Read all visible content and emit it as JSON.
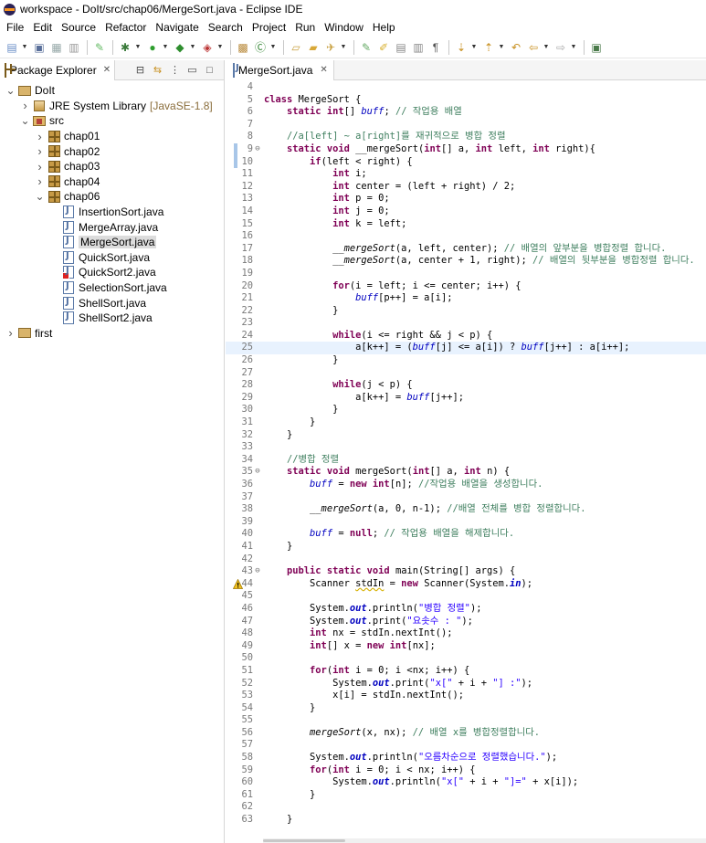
{
  "window": {
    "title": "workspace - DoIt/src/chap06/MergeSort.java - Eclipse IDE"
  },
  "menu": [
    "File",
    "Edit",
    "Source",
    "Refactor",
    "Navigate",
    "Search",
    "Project",
    "Run",
    "Window",
    "Help"
  ],
  "explorer": {
    "tab_label": "Package Explorer",
    "tree": [
      {
        "label": "DoIt",
        "icon": "project-icon",
        "expanded": true,
        "depth": 0
      },
      {
        "label": "JRE System Library",
        "suffix": "[JavaSE-1.8]",
        "icon": "library-icon",
        "expanded": false,
        "depth": 1
      },
      {
        "label": "src",
        "icon": "source-folder-icon",
        "expanded": true,
        "depth": 1
      },
      {
        "label": "chap01",
        "icon": "package-icon",
        "expanded": false,
        "depth": 2
      },
      {
        "label": "chap02",
        "icon": "package-icon",
        "expanded": false,
        "depth": 2
      },
      {
        "label": "chap03",
        "icon": "package-icon",
        "expanded": false,
        "depth": 2
      },
      {
        "label": "chap04",
        "icon": "package-icon",
        "expanded": false,
        "depth": 2
      },
      {
        "label": "chap06",
        "icon": "package-icon",
        "expanded": true,
        "depth": 2
      },
      {
        "label": "InsertionSort.java",
        "icon": "java-file-icon",
        "expanded": false,
        "depth": 3
      },
      {
        "label": "MergeArray.java",
        "icon": "java-file-icon",
        "expanded": false,
        "depth": 3
      },
      {
        "label": "MergeSort.java",
        "icon": "java-file-icon",
        "expanded": false,
        "depth": 3,
        "selected": true
      },
      {
        "label": "QuickSort.java",
        "icon": "java-file-icon",
        "expanded": false,
        "depth": 3
      },
      {
        "label": "QuickSort2.java",
        "icon": "java-file-error-icon",
        "expanded": false,
        "depth": 3
      },
      {
        "label": "SelectionSort.java",
        "icon": "java-file-icon",
        "expanded": false,
        "depth": 3
      },
      {
        "label": "ShellSort.java",
        "icon": "java-file-icon",
        "expanded": false,
        "depth": 3
      },
      {
        "label": "ShellSort2.java",
        "icon": "java-file-icon",
        "expanded": false,
        "depth": 3
      },
      {
        "label": "first",
        "icon": "project-icon",
        "expanded": false,
        "depth": 0
      }
    ]
  },
  "editor": {
    "tab_label": "MergeSort.java",
    "current_line": 25,
    "lines": [
      {
        "n": 4,
        "code": ""
      },
      {
        "n": 5,
        "code": "<span class=\"kw\">class</span> MergeSort {"
      },
      {
        "n": 6,
        "code": "    <span class=\"kw\">static</span> <span class=\"kw\">int</span>[] <span class=\"fi\">buff</span>; <span class=\"cm\">// 작업용 배열</span>"
      },
      {
        "n": 7,
        "code": ""
      },
      {
        "n": 8,
        "code": "    <span class=\"cm\">//a[left] ~ a[right]를 재귀적으로 병합 정렬</span>"
      },
      {
        "n": 9,
        "fold": true,
        "code": "    <span class=\"kw\">static</span> <span class=\"kw\">void</span> __mergeSort(<span class=\"kw\">int</span>[] a, <span class=\"kw\">int</span> left, <span class=\"kw\">int</span> right){"
      },
      {
        "n": 10,
        "code": "        <span class=\"kw\">if</span>(left &lt; right) {"
      },
      {
        "n": 11,
        "code": "            <span class=\"kw\">int</span> i;"
      },
      {
        "n": 12,
        "code": "            <span class=\"kw\">int</span> center = (left + right) / 2;"
      },
      {
        "n": 13,
        "code": "            <span class=\"kw\">int</span> p = 0;"
      },
      {
        "n": 14,
        "code": "            <span class=\"kw\">int</span> j = 0;"
      },
      {
        "n": 15,
        "code": "            <span class=\"kw\">int</span> k = left;"
      },
      {
        "n": 16,
        "code": ""
      },
      {
        "n": 17,
        "code": "            <span class=\"mi\">__mergeSort</span>(a, left, center); <span class=\"cm\">// 배열의 앞부분을 병합정렬 합니다.</span>"
      },
      {
        "n": 18,
        "code": "            <span class=\"mi\">__mergeSort</span>(a, center + 1, right); <span class=\"cm\">// 배열의 뒷부분을 병합정렬 합니다.</span>"
      },
      {
        "n": 19,
        "code": ""
      },
      {
        "n": 20,
        "code": "            <span class=\"kw\">for</span>(i = left; i &lt;= center; i++) {"
      },
      {
        "n": 21,
        "code": "                <span class=\"fi\">buff</span>[p++] = a[i];"
      },
      {
        "n": 22,
        "code": "            }"
      },
      {
        "n": 23,
        "code": ""
      },
      {
        "n": 24,
        "code": "            <span class=\"kw\">while</span>(i &lt;= right &amp;&amp; j &lt; p) {"
      },
      {
        "n": 25,
        "code": "                a[k++] = (<span class=\"fi\">buff</span>[j] &lt;= a[i]) ? <span class=\"fi\">buff</span>[j++] : a[i++];"
      },
      {
        "n": 26,
        "code": "            }"
      },
      {
        "n": 27,
        "code": ""
      },
      {
        "n": 28,
        "code": "            <span class=\"kw\">while</span>(j &lt; p) {"
      },
      {
        "n": 29,
        "code": "                a[k++] = <span class=\"fi\">buff</span>[j++];"
      },
      {
        "n": 30,
        "code": "            }"
      },
      {
        "n": 31,
        "code": "        }"
      },
      {
        "n": 32,
        "code": "    }"
      },
      {
        "n": 33,
        "code": ""
      },
      {
        "n": 34,
        "code": "    <span class=\"cm\">//병합 정렬</span>"
      },
      {
        "n": 35,
        "fold": true,
        "code": "    <span class=\"kw\">static</span> <span class=\"kw\">void</span> mergeSort(<span class=\"kw\">int</span>[] a, <span class=\"kw\">int</span> n) {"
      },
      {
        "n": 36,
        "code": "        <span class=\"fi\">buff</span> = <span class=\"kw\">new</span> <span class=\"kw\">int</span>[n]; <span class=\"cm\">//작업용 배열을 생성합니다.</span>"
      },
      {
        "n": 37,
        "code": ""
      },
      {
        "n": 38,
        "code": "        <span class=\"mi\">__mergeSort</span>(a, 0, n-1); <span class=\"cm\">//배열 전체를 병합 정렬합니다.</span>"
      },
      {
        "n": 39,
        "code": ""
      },
      {
        "n": 40,
        "code": "        <span class=\"fi\">buff</span> = <span class=\"kw\">null</span>; <span class=\"cm\">// 작업용 배열을 해제합니다.</span>"
      },
      {
        "n": 41,
        "code": "    }"
      },
      {
        "n": 42,
        "code": ""
      },
      {
        "n": 43,
        "fold": true,
        "code": "    <span class=\"kw\">public</span> <span class=\"kw\">static</span> <span class=\"kw\">void</span> main(String[] args) {"
      },
      {
        "n": 44,
        "warn": true,
        "code": "        Scanner <span style=\"text-decoration: underline wavy #d6b000;\">stdIn</span> = <span class=\"kw\">new</span> Scanner(System.<span class=\"sf\">in</span>);"
      },
      {
        "n": 45,
        "code": ""
      },
      {
        "n": 46,
        "code": "        System.<span class=\"sf\">out</span>.println(<span class=\"st\">\"병합 정렬\"</span>);"
      },
      {
        "n": 47,
        "code": "        System.<span class=\"sf\">out</span>.print(<span class=\"st\">\"요솟수 : \"</span>);"
      },
      {
        "n": 48,
        "code": "        <span class=\"kw\">int</span> nx = stdIn.nextInt();"
      },
      {
        "n": 49,
        "code": "        <span class=\"kw\">int</span>[] x = <span class=\"kw\">new</span> <span class=\"kw\">int</span>[nx];"
      },
      {
        "n": 50,
        "code": ""
      },
      {
        "n": 51,
        "code": "        <span class=\"kw\">for</span>(<span class=\"kw\">int</span> i = 0; i &lt;nx; i++) {"
      },
      {
        "n": 52,
        "code": "            System.<span class=\"sf\">out</span>.print(<span class=\"st\">\"x[\"</span> + i + <span class=\"st\">\"] :\"</span>);"
      },
      {
        "n": 53,
        "code": "            x[i] = stdIn.nextInt();"
      },
      {
        "n": 54,
        "code": "        }"
      },
      {
        "n": 55,
        "code": ""
      },
      {
        "n": 56,
        "code": "        <span class=\"mi\">mergeSort</span>(x, nx); <span class=\"cm\">// 배열 x를 병합정렬합니다.</span>"
      },
      {
        "n": 57,
        "code": ""
      },
      {
        "n": 58,
        "code": "        System.<span class=\"sf\">out</span>.println(<span class=\"st\">\"오름차순으로 정렬했습니다.\"</span>);"
      },
      {
        "n": 59,
        "code": "        <span class=\"kw\">for</span>(<span class=\"kw\">int</span> i = 0; i &lt; nx; i++) {"
      },
      {
        "n": 60,
        "code": "            System.<span class=\"sf\">out</span>.println(<span class=\"st\">\"x[\"</span> + i + <span class=\"st\">\"]=\"</span> + x[i]);"
      },
      {
        "n": 61,
        "code": "        }"
      },
      {
        "n": 62,
        "code": ""
      },
      {
        "n": 63,
        "code": "    }"
      }
    ]
  }
}
